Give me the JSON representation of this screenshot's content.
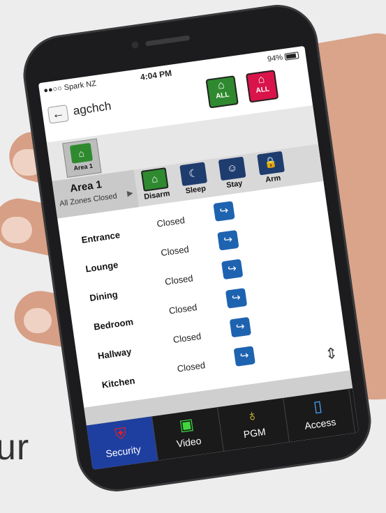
{
  "status_bar": {
    "carrier": "●●○○ Spark NZ",
    "time": "4:04 PM",
    "battery": "94%"
  },
  "header": {
    "account": "agchch",
    "all_unlock_label": "ALL",
    "all_lock_label": "ALL"
  },
  "area_tile": {
    "label": "Area 1"
  },
  "area": {
    "name": "Area 1",
    "status": "All Zones Closed"
  },
  "modes": [
    {
      "label": "Disarm",
      "icon": "house-unlock-icon",
      "active": true
    },
    {
      "label": "Sleep",
      "icon": "bed-icon",
      "active": false
    },
    {
      "label": "Stay",
      "icon": "person-icon",
      "active": false
    },
    {
      "label": "Arm",
      "icon": "padlock-icon",
      "active": false
    }
  ],
  "zones": [
    {
      "name": "Entrance",
      "status": "Closed"
    },
    {
      "name": "Lounge",
      "status": "Closed"
    },
    {
      "name": "Dining",
      "status": "Closed"
    },
    {
      "name": "Bedroom",
      "status": "Closed"
    },
    {
      "name": "Hallway",
      "status": "Closed"
    },
    {
      "name": "Kitchen",
      "status": "Closed"
    }
  ],
  "tabs": [
    {
      "label": "Security",
      "icon": "shield-icon",
      "active": true
    },
    {
      "label": "Video",
      "icon": "video-camera-icon",
      "active": false
    },
    {
      "label": "PGM",
      "icon": "lightbulb-icon",
      "active": false
    },
    {
      "label": "Access",
      "icon": "door-icon",
      "active": false
    }
  ],
  "background_text": "ur",
  "colors": {
    "disarm_green": "#2f8a2f",
    "arm_red": "#d9144a",
    "mode_blue": "#1f3c6e",
    "tab_active": "#1e3fa0"
  }
}
